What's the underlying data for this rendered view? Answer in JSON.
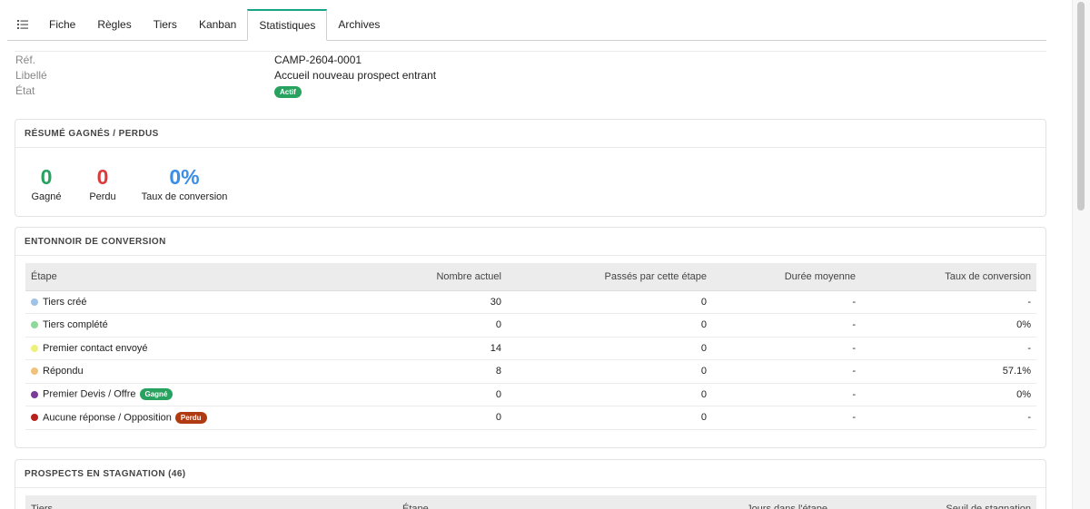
{
  "tabs": [
    {
      "label": "Fiche"
    },
    {
      "label": "Règles"
    },
    {
      "label": "Tiers"
    },
    {
      "label": "Kanban"
    },
    {
      "label": "Statistiques",
      "active": true
    },
    {
      "label": "Archives"
    }
  ],
  "fields": {
    "ref_label": "Réf.",
    "ref_value": "CAMP-2604-0001",
    "libelle_label": "Libellé",
    "libelle_value": "Accueil nouveau prospect entrant",
    "etat_label": "État",
    "etat_value": "Actif"
  },
  "summary": {
    "title": "RÉSUMÉ GAGNÉS / PERDUS",
    "won_value": "0",
    "won_label": "Gagné",
    "lost_value": "0",
    "lost_label": "Perdu",
    "rate_value": "0%",
    "rate_label": "Taux de conversion",
    "colors": {
      "won": "#27a25f",
      "lost": "#dc3b3b",
      "rate": "#3a8ee6"
    }
  },
  "funnel": {
    "title": "ENTONNOIR DE CONVERSION",
    "columns": [
      "Étape",
      "Nombre actuel",
      "Passés par cette étape",
      "Durée moyenne",
      "Taux de conversion"
    ],
    "rows": [
      {
        "color": "#9ec3e6",
        "stage": "Tiers créé",
        "badge": "",
        "count": "30",
        "passed": "0",
        "duration": "-",
        "rate": "-"
      },
      {
        "color": "#8ed99a",
        "stage": "Tiers complété",
        "badge": "",
        "count": "0",
        "passed": "0",
        "duration": "-",
        "rate": "0%"
      },
      {
        "color": "#eef07a",
        "stage": "Premier contact envoyé",
        "badge": "",
        "count": "14",
        "passed": "0",
        "duration": "-",
        "rate": "-"
      },
      {
        "color": "#f1c27a",
        "stage": "Répondu",
        "badge": "",
        "count": "8",
        "passed": "0",
        "duration": "-",
        "rate": "57.1%"
      },
      {
        "color": "#7a3b9a",
        "stage": "Premier Devis / Offre",
        "badge": "Gagné",
        "badge_color": "green",
        "count": "0",
        "passed": "0",
        "duration": "-",
        "rate": "0%"
      },
      {
        "color": "#b8211e",
        "stage": "Aucune réponse / Opposition",
        "badge": "Perdu",
        "badge_color": "red",
        "count": "0",
        "passed": "0",
        "duration": "-",
        "rate": "-"
      }
    ]
  },
  "stagnation": {
    "title": "PROSPECTS EN STAGNATION (46)",
    "columns": [
      "Tiers",
      "Étape",
      "Jours dans l'étape",
      "Seuil de stagnation"
    ]
  }
}
